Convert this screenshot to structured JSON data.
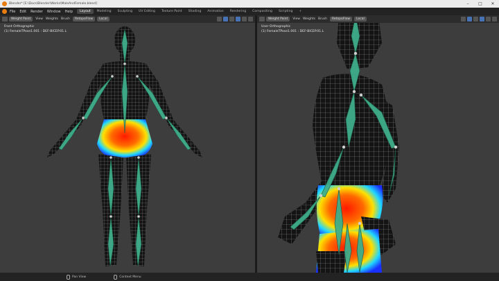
{
  "window": {
    "title": "Blender* [E:\\Docs\\Blender\\Works\\MaleAndFemale.blend]"
  },
  "menu": [
    "File",
    "Edit",
    "Render",
    "Window",
    "Help"
  ],
  "workspaces": [
    {
      "label": "Layout",
      "active": true
    },
    {
      "label": "Modeling",
      "active": false
    },
    {
      "label": "Sculpting",
      "active": false
    },
    {
      "label": "UV Editing",
      "active": false
    },
    {
      "label": "Texture Paint",
      "active": false
    },
    {
      "label": "Shading",
      "active": false
    },
    {
      "label": "Animation",
      "active": false
    },
    {
      "label": "Rendering",
      "active": false
    },
    {
      "label": "Compositing",
      "active": false
    },
    {
      "label": "Scripting",
      "active": false
    },
    {
      "label": "+",
      "active": false
    }
  ],
  "viewport_header": {
    "mode": "Weight Paint",
    "menus": [
      "View",
      "Weights",
      "Brush"
    ],
    "falloff": "RetopoFlow",
    "orientation": "Local"
  },
  "left_view": {
    "view_name": "Front Orthographic",
    "object": "(1) FemaleTPose1.001 : DEF-BICEP.01.L"
  },
  "right_view": {
    "view_name": "User Orthographic",
    "object": "(1) FemaleTPose1.001 : DEF-BICEP.01.L"
  },
  "status": {
    "left": "Pan View",
    "middle": "Context Menu"
  },
  "colors": {
    "viewport_bg": "#3d3d3d",
    "mesh_dark": "#141414",
    "wire": "#9a9a9a",
    "bone": "#3fae8a",
    "accent": "#4772b3",
    "orange": "#e87d0d"
  }
}
